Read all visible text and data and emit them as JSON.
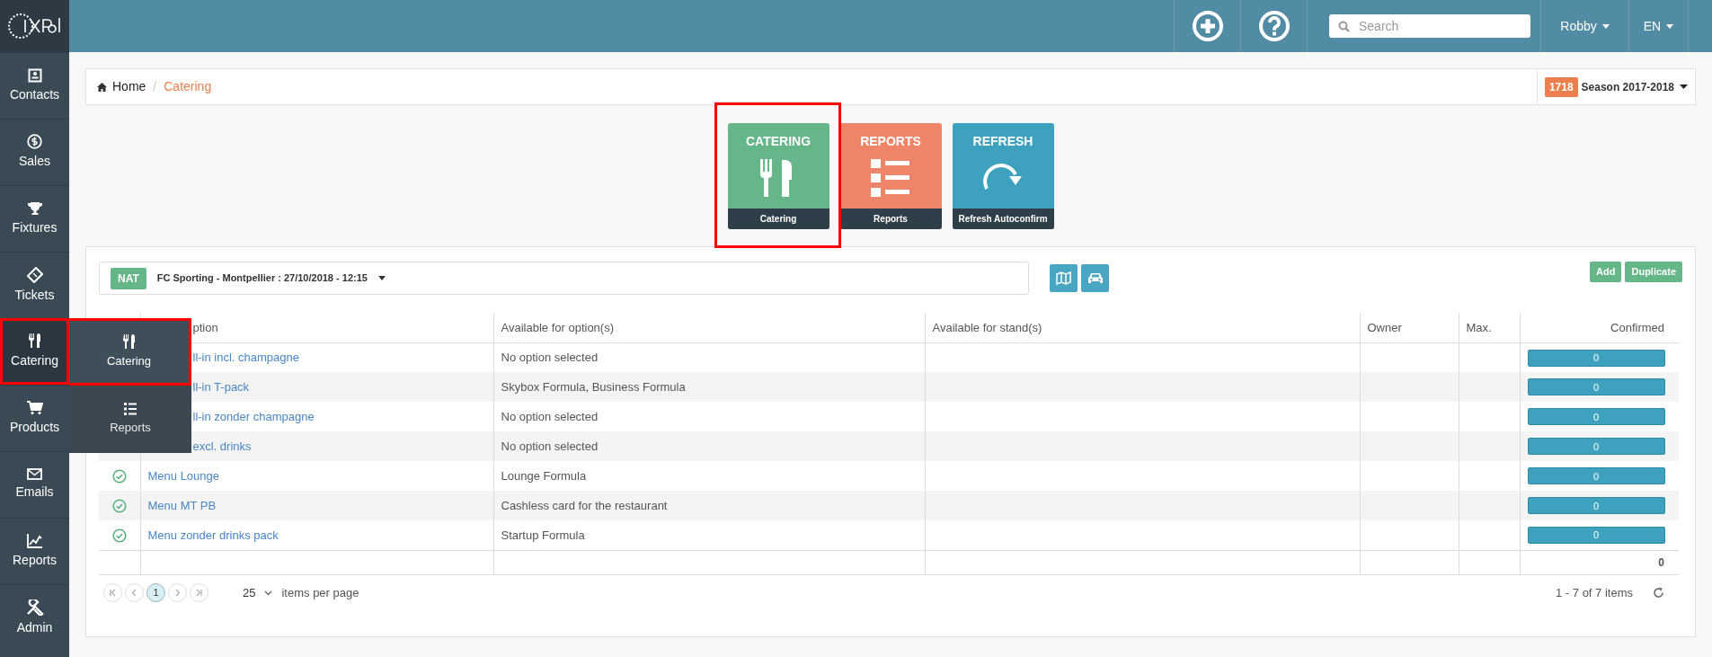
{
  "top_bar": {
    "search": {
      "placeholder": "Search"
    },
    "user": "Robby",
    "language": "EN"
  },
  "sidebar": {
    "items": [
      {
        "label": "Contacts",
        "selected": false
      },
      {
        "label": "Sales",
        "selected": false
      },
      {
        "label": "Fixtures",
        "selected": false
      },
      {
        "label": "Tickets",
        "selected": false
      },
      {
        "label": "Catering",
        "selected": true
      },
      {
        "label": "Products",
        "selected": false
      },
      {
        "label": "Emails",
        "selected": false
      },
      {
        "label": "Reports",
        "selected": false
      },
      {
        "label": "Admin",
        "selected": false
      }
    ]
  },
  "submenu": {
    "items": [
      {
        "label": "Catering",
        "selected": true
      },
      {
        "label": "Reports",
        "selected": false
      }
    ]
  },
  "breadcrumb": [
    "Home",
    "Catering"
  ],
  "breadcrumb_separator": "/",
  "season": {
    "badge": "1718",
    "label": "Season 2017-2018"
  },
  "tiles": [
    {
      "kind": "catering",
      "title": "CATERING",
      "caption": "Catering",
      "color": "#65b688"
    },
    {
      "kind": "reports",
      "title": "REPORTS",
      "caption": "Reports",
      "color": "#ee8468"
    },
    {
      "kind": "refresh",
      "title": "REFRESH",
      "caption": "Refresh Autoconfirm",
      "color": "#3ea1bd"
    }
  ],
  "fixture": {
    "badge": "NAT",
    "label": "FC Sporting - Montpellier : 27/10/2018 - 12:15"
  },
  "actions": [
    "Add",
    "Duplicate"
  ],
  "table": {
    "columns": [
      {
        "label": "ption",
        "covered": true
      },
      {
        "label": "Available for option(s)",
        "covered": false
      },
      {
        "label": "Available for stand(s)",
        "covered": false
      },
      {
        "label": "Owner",
        "covered": false
      },
      {
        "label": "Max.",
        "covered": false
      },
      {
        "label": "Confirmed",
        "covered": false
      }
    ],
    "rows": [
      {
        "description": "ll-in incl. champagne",
        "covered": true,
        "options": "No option selected",
        "confirmed": "0"
      },
      {
        "description": "ll-in T-pack",
        "covered": true,
        "options": "Skybox Formula, Business Formula",
        "confirmed": "0"
      },
      {
        "description": "ll-in zonder champagne",
        "covered": true,
        "options": "No option selected",
        "confirmed": "0"
      },
      {
        "description": "excl. drinks",
        "covered": true,
        "options": "No option selected",
        "confirmed": "0"
      },
      {
        "description": "Menu Lounge",
        "covered": false,
        "options": "Lounge Formula",
        "confirmed": "0"
      },
      {
        "description": "Menu MT PB",
        "covered": false,
        "options": "Cashless card for the restaurant",
        "confirmed": "0"
      },
      {
        "description": "Menu zonder drinks pack",
        "covered": false,
        "options": "Startup Formula",
        "confirmed": "0"
      }
    ],
    "total": "0"
  },
  "pagination": {
    "pages": [
      {
        "label": "1",
        "selected": true
      }
    ],
    "page_size": "25",
    "page_size_label": "items per page",
    "summary": "1 - 7 of 7 items"
  }
}
